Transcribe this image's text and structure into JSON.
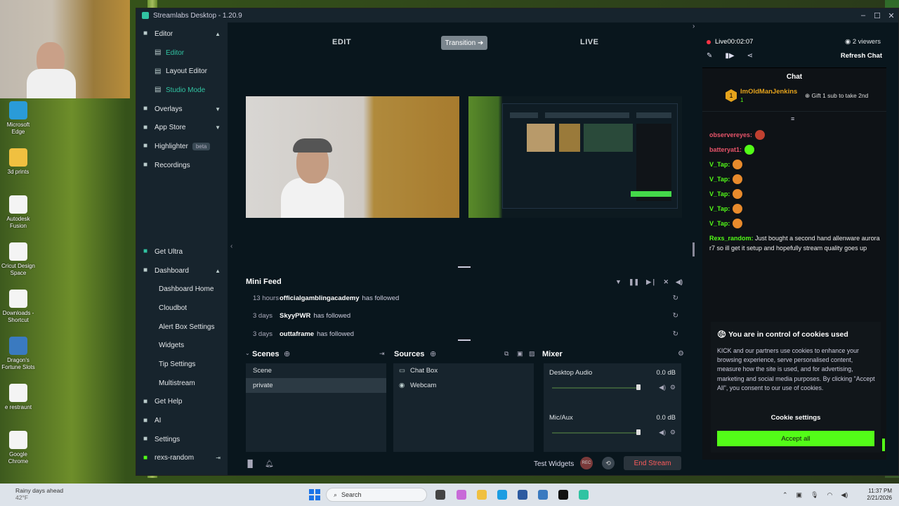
{
  "desktop": {
    "icons": [
      {
        "label": "Microsoft Edge",
        "color": "#2a9bd8"
      },
      {
        "label": "3d prints",
        "color": "#f0c040"
      },
      {
        "label": "Autodesk Fusion",
        "color": "#f4f4f4"
      },
      {
        "label": "Cricut Design Space",
        "color": "#f4f4f4"
      },
      {
        "label": "Downloads - Shortcut",
        "color": "#f4f4f4"
      },
      {
        "label": "Dragon's Fortune Slots",
        "color": "#3a7ac0"
      },
      {
        "label": "e restraunt",
        "color": "#f4f4f4"
      },
      {
        "label": "Google Chrome",
        "color": "#f4f4f4"
      }
    ]
  },
  "window": {
    "title": "Streamlabs Desktop - 1.20.9",
    "controls": [
      "–",
      "☐",
      "✕"
    ]
  },
  "sidebar": {
    "items": [
      {
        "label": "Editor",
        "icon": "editor-icon",
        "chevron": "▲",
        "type": "top"
      },
      {
        "label": "Editor",
        "icon": "editor-sub-icon",
        "type": "sub",
        "active": true
      },
      {
        "label": "Layout Editor",
        "icon": "layout-icon",
        "type": "sub"
      },
      {
        "label": "Studio Mode",
        "icon": "studio-icon",
        "type": "sub",
        "active": true
      },
      {
        "label": "Overlays",
        "icon": "overlays-icon",
        "chevron": "▼",
        "type": "top"
      },
      {
        "label": "App Store",
        "icon": "store-icon",
        "chevron": "▼",
        "type": "top"
      },
      {
        "label": "Highlighter",
        "icon": "highlighter-icon",
        "badge": "beta",
        "type": "top"
      },
      {
        "label": "Recordings",
        "icon": "recordings-icon",
        "type": "top"
      }
    ],
    "bottom_items": [
      {
        "label": "Get Ultra",
        "icon": "ultra-icon",
        "type": "top"
      },
      {
        "label": "Dashboard",
        "icon": "dashboard-icon",
        "chevron": "▲",
        "type": "top"
      },
      {
        "label": "Dashboard Home",
        "type": "sub"
      },
      {
        "label": "Cloudbot",
        "type": "sub"
      },
      {
        "label": "Alert Box Settings",
        "type": "sub"
      },
      {
        "label": "Widgets",
        "type": "sub"
      },
      {
        "label": "Tip Settings",
        "type": "sub"
      },
      {
        "label": "Multistream",
        "type": "sub"
      },
      {
        "label": "Get Help",
        "icon": "help-icon",
        "type": "top"
      },
      {
        "label": "AI",
        "icon": "ai-icon",
        "type": "top"
      },
      {
        "label": "Settings",
        "icon": "settings-icon",
        "type": "top"
      },
      {
        "label": "rexs-random",
        "icon": "kick-icon",
        "type": "top"
      }
    ]
  },
  "studio": {
    "edit_label": "EDIT",
    "transition_label": "Transition ➔",
    "live_label": "LIVE"
  },
  "minifeed": {
    "title": "Mini Feed",
    "rows": [
      {
        "time": "13 hours",
        "user": "officialgamblingacademy",
        "action": "has followed"
      },
      {
        "time": "3 days",
        "user": "SkyyPWR",
        "action": "has followed"
      },
      {
        "time": "3 days",
        "user": "outtaframe",
        "action": "has followed"
      }
    ]
  },
  "scenes": {
    "title": "Scenes",
    "items": [
      "Scene",
      "private"
    ],
    "selected": 1
  },
  "sources": {
    "title": "Sources",
    "items": [
      {
        "label": "Chat Box",
        "icon": "chat-box-icon"
      },
      {
        "label": "Webcam",
        "icon": "webcam-icon"
      }
    ]
  },
  "mixer": {
    "title": "Mixer",
    "channels": [
      {
        "label": "Desktop Audio",
        "db": "0.0 dB"
      },
      {
        "label": "Mic/Aux",
        "db": "0.0 dB"
      }
    ]
  },
  "footer": {
    "test_widgets": "Test Widgets",
    "rec_label": "REC",
    "end_stream": "End Stream"
  },
  "live": {
    "status": "Live",
    "timer": "00:02:07",
    "viewers": "2 viewers",
    "refresh": "Refresh Chat"
  },
  "chat": {
    "title": "Chat",
    "pinned": {
      "user": "ImOldManJenkins",
      "badge": "1",
      "count": "1",
      "gift": "Gift 1 sub to take 2nd"
    },
    "lines": [
      {
        "user": "observereyes",
        "color": "#e8546a",
        "emote": "e1"
      },
      {
        "user": "batteryat1",
        "color": "#e8546a",
        "emote": "e2"
      },
      {
        "user": "V_Tap",
        "color": "#53fc18",
        "emote": "e3"
      },
      {
        "user": "V_Tap",
        "color": "#53fc18",
        "emote": "e3"
      },
      {
        "user": "V_Tap",
        "color": "#53fc18",
        "emote": "e3"
      },
      {
        "user": "V_Tap",
        "color": "#53fc18",
        "emote": "e3"
      },
      {
        "user": "V_Tap",
        "color": "#53fc18",
        "emote": "e3"
      }
    ],
    "message": {
      "user": "Rexs_random",
      "text": "Just bought a second hand allenware aurora r7 so ill get it setup and hopefully stream quality goes up"
    }
  },
  "cookie": {
    "title": "You are in control of cookies used",
    "body": "KICK and our partners use cookies to enhance your browsing experience, serve personalised content, measure how the site is used, and for advertising, marketing and social media purposes. By clicking \"Accept All\", you consent to our use of cookies.",
    "settings": "Cookie settings",
    "accept": "Accept all"
  },
  "taskbar": {
    "weather_title": "Rainy days ahead",
    "weather_temp": "42°F",
    "search": "Search",
    "time": "11:37 PM",
    "date": "2/21/2026"
  },
  "colors": {
    "accent": "#31c3a2",
    "kick_green": "#53fc18",
    "live_red": "#ff3344"
  }
}
